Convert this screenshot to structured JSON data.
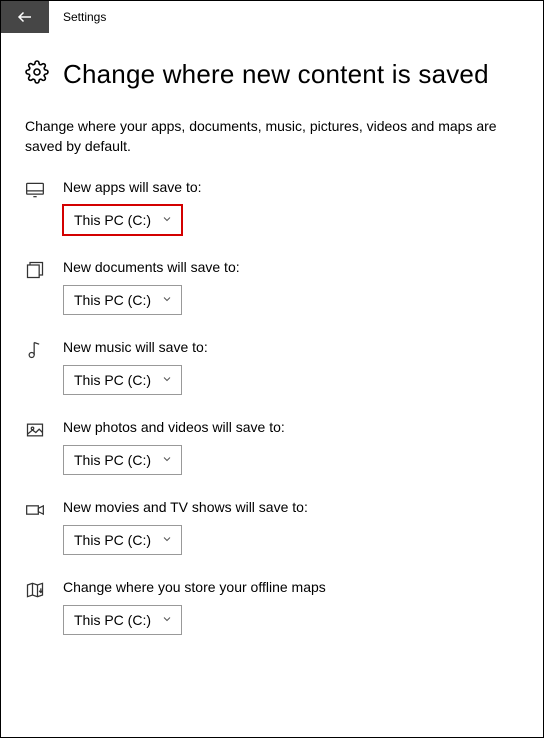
{
  "window": {
    "title": "Settings"
  },
  "page": {
    "heading": "Change where new content is saved",
    "description": "Change where your apps, documents, music, pictures, videos and maps are saved by default."
  },
  "settings": {
    "apps": {
      "label": "New apps will save to:",
      "value": "This PC (C:)",
      "highlighted": true
    },
    "documents": {
      "label": "New documents will save to:",
      "value": "This PC (C:)"
    },
    "music": {
      "label": "New music will save to:",
      "value": "This PC (C:)"
    },
    "photos": {
      "label": "New photos and videos will save to:",
      "value": "This PC (C:)"
    },
    "movies": {
      "label": "New movies and TV shows will save to:",
      "value": "This PC (C:)"
    },
    "maps": {
      "label": "Change where you store your offline maps",
      "value": "This PC (C:)"
    }
  }
}
